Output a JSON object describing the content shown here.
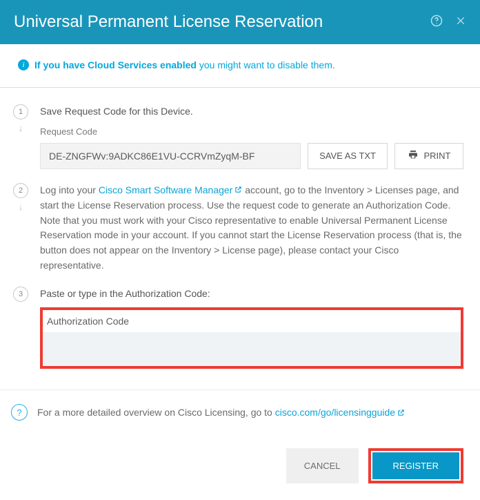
{
  "header": {
    "title": "Universal Permanent License Reservation"
  },
  "info": {
    "bold": "If you have Cloud Services enabled",
    "rest": " you might want to disable them."
  },
  "step1": {
    "num": "1",
    "title": "Save Request Code for this Device.",
    "label": "Request Code",
    "code": "DE-ZNGFWv:9ADKC86E1VU-CCRVmZyqM-BF",
    "save_txt": "SAVE AS TXT",
    "print": "PRINT"
  },
  "step2": {
    "num": "2",
    "pre": "Log into your ",
    "link": "Cisco Smart Software Manager",
    "post": " account, go to the Inventory > Licenses page, and start the License Reservation process. Use the request code to generate an Authorization Code. Note that you must work with your Cisco representative to enable Universal Permanent License Reservation mode in your account. If you cannot start the License Reservation process (that is, the button does not appear on the Inventory > License page), please contact your Cisco representative."
  },
  "step3": {
    "num": "3",
    "title": "Paste or type in the Authorization Code:",
    "auth_label": "Authorization Code",
    "auth_placeholder": ""
  },
  "hint": {
    "pre": "For a more detailed overview on Cisco Licensing, go to ",
    "link": "cisco.com/go/licensingguide"
  },
  "footer": {
    "cancel": "CANCEL",
    "register": "REGISTER"
  }
}
